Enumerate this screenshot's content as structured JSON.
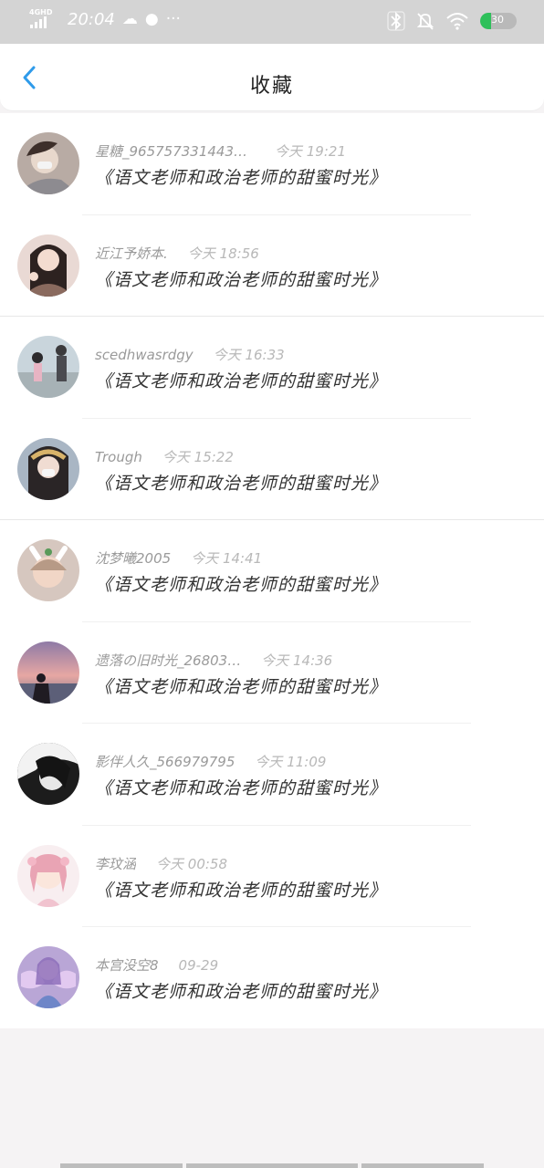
{
  "status_bar": {
    "network": "4GHD",
    "time": "20:04",
    "battery_level": "30",
    "battery_fraction": 0.3,
    "icons": [
      "signal-icon",
      "cloud-icon",
      "app-icon",
      "more-icon",
      "bluetooth-icon",
      "mute-icon",
      "wifi-icon",
      "battery-icon"
    ]
  },
  "header": {
    "title": "收藏",
    "back_icon": "chevron-left-icon"
  },
  "favorites": [
    {
      "user": "星糖_9657573314433…",
      "time": "今天 19:21",
      "title": "《语文老师和政治老师的甜蜜时光》"
    },
    {
      "user": "近江予娇本.",
      "time": "今天 18:56",
      "title": "《语文老师和政治老师的甜蜜时光》"
    },
    {
      "user": "scedhwasrdgy",
      "time": "今天 16:33",
      "title": "《语文老师和政治老师的甜蜜时光》"
    },
    {
      "user": "Trough",
      "time": "今天 15:22",
      "title": "《语文老师和政治老师的甜蜜时光》"
    },
    {
      "user": "沈梦曦2005",
      "time": "今天 14:41",
      "title": "《语文老师和政治老师的甜蜜时光》"
    },
    {
      "user": "遗落の旧时光_26803…",
      "time": "今天 14:36",
      "title": "《语文老师和政治老师的甜蜜时光》"
    },
    {
      "user": "影伴人久_566979795",
      "time": "今天 11:09",
      "title": "《语文老师和政治老师的甜蜜时光》"
    },
    {
      "user": "李玟涵",
      "time": "今天 00:58",
      "title": "《语文老师和政治老师的甜蜜时光》"
    },
    {
      "user": "本宫没空8",
      "time": "09-29",
      "title": "《语文老师和政治老师的甜蜜时光》"
    }
  ],
  "colors": {
    "accent": "#2f9bea",
    "status_bar_bg": "#d4d4d4",
    "battery_green": "#2ec05a"
  }
}
